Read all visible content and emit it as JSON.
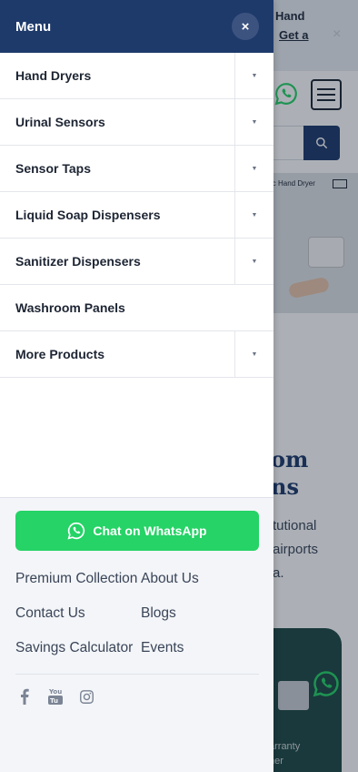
{
  "background": {
    "topbar_line1": "Hand",
    "topbar_link": "Get a",
    "topbar_close": "×",
    "banner_caption": "ic Hand Dryer",
    "heading_line1": "om",
    "heading_line2": "ns",
    "body_line1": "tutional",
    "body_line2": "airports",
    "body_line3": "a.",
    "card_text_line1": "arranty",
    "card_text_line2": "ner"
  },
  "drawer": {
    "title": "Menu",
    "close_label": "×",
    "items": [
      {
        "label": "Hand Dryers",
        "has_submenu": true
      },
      {
        "label": "Urinal Sensors",
        "has_submenu": true
      },
      {
        "label": "Sensor Taps",
        "has_submenu": true
      },
      {
        "label": "Liquid Soap Dispensers",
        "has_submenu": true
      },
      {
        "label": "Sanitizer Dispensers",
        "has_submenu": true
      },
      {
        "label": "Washroom Panels",
        "has_submenu": false
      },
      {
        "label": "More Products",
        "has_submenu": true
      }
    ],
    "toggle_glyph": "▼",
    "whatsapp_label": "Chat on WhatsApp",
    "footer_links": [
      {
        "label": "Premium Collection"
      },
      {
        "label": "About Us"
      },
      {
        "label": "Contact Us"
      },
      {
        "label": "Blogs"
      },
      {
        "label": "Savings Calculator"
      },
      {
        "label": "Events"
      }
    ],
    "social": [
      "facebook-icon",
      "youtube-icon",
      "instagram-icon"
    ]
  },
  "colors": {
    "brand_navy": "#1e3a6b",
    "whatsapp_green": "#25d366",
    "text_dark": "#1d2533",
    "text_muted": "#3a4558"
  }
}
